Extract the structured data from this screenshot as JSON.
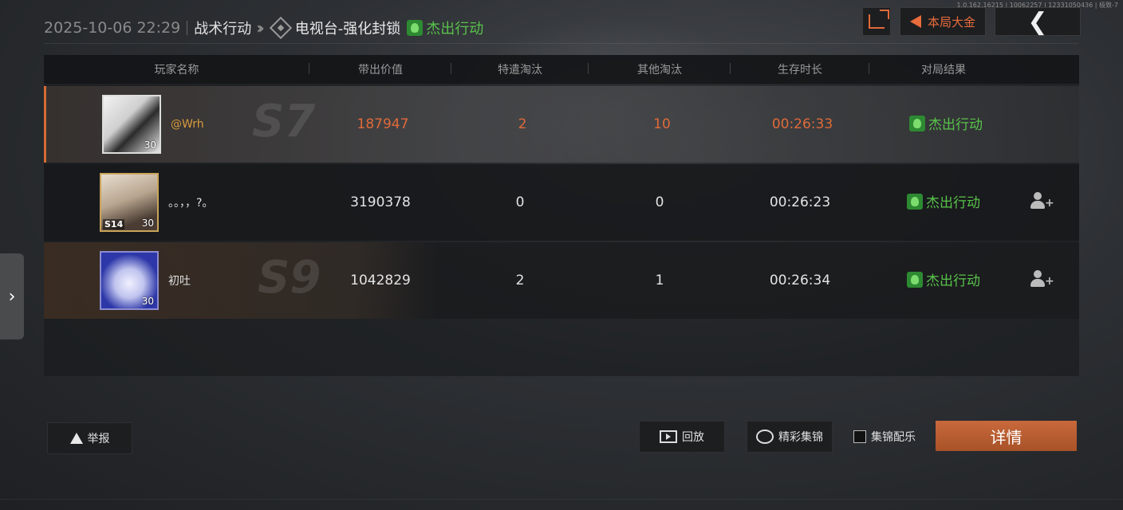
{
  "version_text": "1.0.162.16215 | 10062257 | 12331050436 | 极致-7",
  "header": {
    "datetime": "2025-10-06 22:29",
    "mode": "战术行动",
    "map": "电视台-强化封锁",
    "result": "杰出行动"
  },
  "top_buttons": {
    "bounty_label": "本局大金"
  },
  "columns": [
    "玩家名称",
    "带出价值",
    "特遣淘汰",
    "其他淘汰",
    "生存时长",
    "对局结果"
  ],
  "players": [
    {
      "name": "@Wrh",
      "level": "30",
      "season": "",
      "badge": "S7",
      "value": "187947",
      "squad_kills": "2",
      "other_kills": "10",
      "survival": "00:26:33",
      "result": "杰出行动",
      "self": true
    },
    {
      "name": "。。，，?。",
      "level": "30",
      "season": "S14",
      "badge": "",
      "value": "3190378",
      "squad_kills": "0",
      "other_kills": "0",
      "survival": "00:26:23",
      "result": "杰出行动",
      "self": false
    },
    {
      "name": "初吐",
      "level": "30",
      "season": "",
      "badge": "S9",
      "value": "1042829",
      "squad_kills": "2",
      "other_kills": "1",
      "survival": "00:26:34",
      "result": "杰出行动",
      "self": false
    }
  ],
  "bottom": {
    "report_label": "举报",
    "replay_label": "回放",
    "highlights_label": "精彩集锦",
    "music_label": "集锦配乐",
    "detail_label": "详情"
  },
  "colors": {
    "accent": "#e06a3a",
    "success": "#58c24a"
  }
}
